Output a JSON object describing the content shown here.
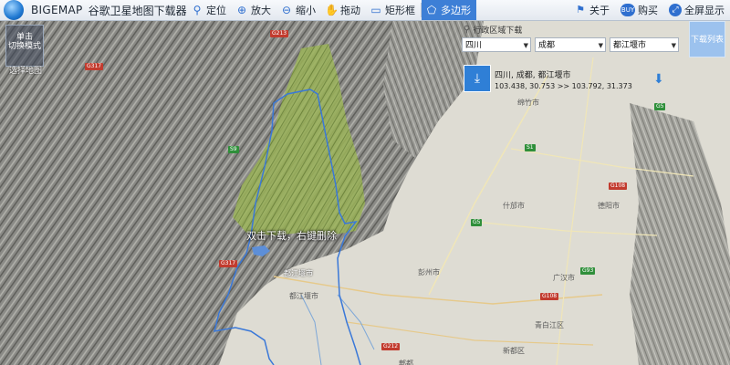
{
  "app": {
    "brand": "BIGEMAP",
    "title": "谷歌卫星地图下载器"
  },
  "toolbar": {
    "items": [
      {
        "label": "定位",
        "icon": "pin-icon"
      },
      {
        "label": "放大",
        "icon": "zoom-in-icon"
      },
      {
        "label": "缩小",
        "icon": "zoom-out-icon"
      },
      {
        "label": "拖动",
        "icon": "hand-icon"
      },
      {
        "label": "矩形框",
        "icon": "rectangle-icon"
      },
      {
        "label": "多边形",
        "icon": "polygon-icon"
      }
    ],
    "right": [
      {
        "label": "关于",
        "icon": "about-icon"
      },
      {
        "label": "购买",
        "icon": "buy-icon"
      },
      {
        "label": "全屏显示",
        "icon": "fullscreen-icon"
      }
    ]
  },
  "left_panel": {
    "switch_text_line1": "单击",
    "switch_text_line2": "切换模式",
    "caption": "选择地图"
  },
  "region_panel": {
    "title": "行政区域下载",
    "province": "四川",
    "city": "成都",
    "district": "都江堰市",
    "selected_path": "四川, 成都, 都江堰市",
    "coords": "103.438, 30.753 >> 103.792, 31.373"
  },
  "download_list_label": "下载列表",
  "map_hint": "双击下载，右键删除",
  "map_labels": [
    "绵竹市",
    "什邡市",
    "德阳市",
    "彭州市",
    "广汉市",
    "都江堰市",
    "青白江区",
    "新都区",
    "郫都",
    "都江堰市"
  ],
  "road_badges": [
    "G213",
    "G317",
    "S9",
    "G317",
    "S1",
    "G5",
    "G5",
    "G93",
    "G108",
    "G212",
    "G108"
  ],
  "colors": {
    "accent": "#2f7fd6",
    "active_tool": "#3d7fd6",
    "boundary": "#3a78d8",
    "highlight": "#a8c050"
  }
}
